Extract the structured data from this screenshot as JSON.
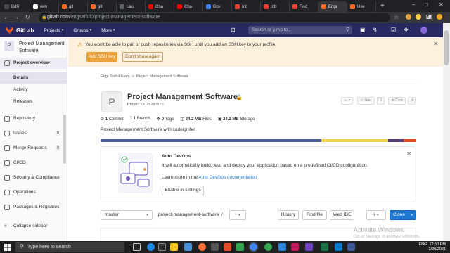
{
  "browser": {
    "tabs": [
      {
        "label": "BdR",
        "color": "#4a4a4a"
      },
      {
        "label": "rem",
        "color": "#ffffff"
      },
      {
        "label": "git",
        "color": "#fc6d26"
      },
      {
        "label": "git",
        "color": "#fc6d26"
      },
      {
        "label": "Lau",
        "color": "#5f6368"
      },
      {
        "label": "Cha",
        "color": "#ff0000"
      },
      {
        "label": "Cha",
        "color": "#ff0000"
      },
      {
        "label": "Dov",
        "color": "#4285f4"
      },
      {
        "label": "Inb",
        "color": "#ea4335"
      },
      {
        "label": "Inb",
        "color": "#ea4335"
      },
      {
        "label": "Fwd",
        "color": "#ea4335"
      },
      {
        "label": "Engr",
        "color": "#fc6d26",
        "active": true
      },
      {
        "label": "Use",
        "color": "#fc6d26"
      }
    ],
    "url_host": "gitlab.com",
    "url_path": "/engsaiful0/project-management-software"
  },
  "gitlab_nav": {
    "brand": "GitLab",
    "menus": [
      "Projects",
      "Groups",
      "More"
    ],
    "search_placeholder": "Search or jump to..."
  },
  "sidebar": {
    "project_letter": "P",
    "project_name": "Project Management Software",
    "items": [
      {
        "label": "Project overview",
        "icon": "home-icon"
      },
      {
        "label": "Details"
      },
      {
        "label": "Activity"
      },
      {
        "label": "Releases"
      },
      {
        "label": "Repository",
        "icon": "book-icon"
      },
      {
        "label": "Issues",
        "icon": "issues-icon",
        "count": "0"
      },
      {
        "label": "Merge Requests",
        "icon": "merge-request-icon",
        "count": "0"
      },
      {
        "label": "CI/CD",
        "icon": "rocket-icon"
      },
      {
        "label": "Security & Compliance",
        "icon": "shield-icon"
      },
      {
        "label": "Operations",
        "icon": "cloud-icon"
      },
      {
        "label": "Packages & Registries",
        "icon": "package-icon"
      }
    ],
    "collapse_label": "Collapse sidebar"
  },
  "banner": {
    "message": "You won't be able to pull or push repositories via SSH until you add an SSH key to your profile",
    "add_ssh_label": "Add SSH key",
    "dont_show_label": "Don't show again"
  },
  "breadcrumb": {
    "owner": "Engr Saiful Islam",
    "separator": ">",
    "project": "Project Management Software"
  },
  "project": {
    "letter": "P",
    "title": "Project Management Software",
    "id_text": "Project ID: 25287576",
    "star_label": "Star",
    "star_count": "0",
    "fork_label": "Fork",
    "fork_count": "0",
    "stats": {
      "commits": {
        "value": "1",
        "label": "Commit"
      },
      "branches": {
        "value": "1",
        "label": "Branch"
      },
      "tags": {
        "value": "0",
        "label": "Tags"
      },
      "files": {
        "value": "24.2 MB",
        "label": "Files"
      },
      "storage": {
        "value": "24.2 MB",
        "label": "Storage"
      }
    },
    "description": "Project Management Software with codeigniter",
    "language_bar": [
      {
        "fraction": 0.7,
        "color": "#4b5b9c"
      },
      {
        "fraction": 0.21,
        "color": "#f0d34b"
      },
      {
        "fraction": 0.05,
        "color": "#563d7c"
      },
      {
        "fraction": 0.04,
        "color": "#e34c26"
      }
    ]
  },
  "autodevops": {
    "title": "Auto DevOps",
    "text": "It will automatically build, test, and deploy your application based on a predefined CI/CD configuration.",
    "learn_prefix": "Learn more in the",
    "learn_link": "Auto DevOps documentation",
    "enable_label": "Enable in settings"
  },
  "repo_controls": {
    "branch": "master",
    "path": "project-management-software",
    "sep": "/",
    "add_label": "+",
    "history_label": "History",
    "find_file_label": "Find file",
    "web_ide_label": "Web IDE",
    "clone_label": "Clone"
  },
  "watermark": {
    "title": "Activate Windows",
    "subtitle": "Go to Settings to activate Windows."
  },
  "taskbar": {
    "search_placeholder": "Type here to search",
    "time": "12:50 PM",
    "date": "3/20/2021",
    "lang": "ENG"
  }
}
